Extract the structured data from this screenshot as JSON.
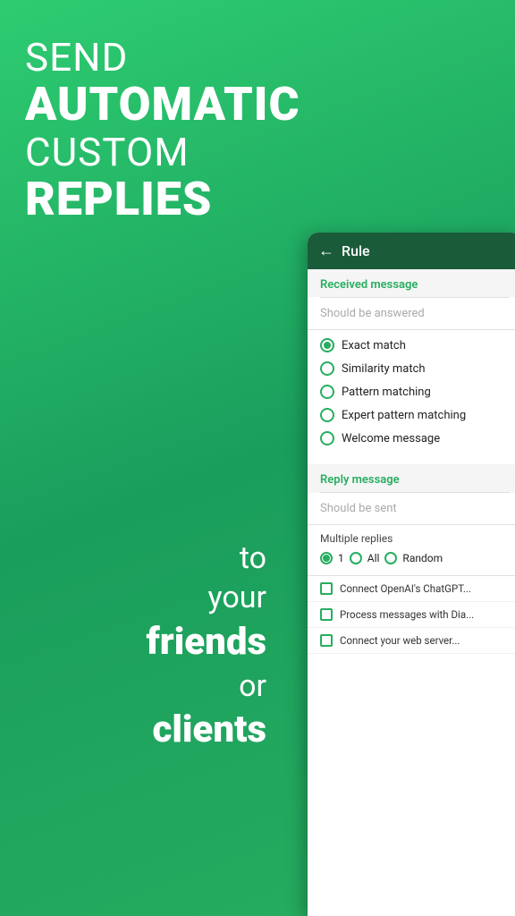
{
  "hero": {
    "send": "SEND",
    "automatic": "AUTOMATIC",
    "custom": "CUSTOM",
    "replies": "REPLIES"
  },
  "bottom": {
    "to": "to",
    "your": "your",
    "friends": "friends",
    "or": "or",
    "clients": "clients"
  },
  "topbar": {
    "back": "←",
    "title": "Rule"
  },
  "received_section": {
    "label": "Received message",
    "placeholder": "Should be answered"
  },
  "radio_options": [
    {
      "label": "Exact match",
      "selected": true
    },
    {
      "label": "Similarity match",
      "selected": false
    },
    {
      "label": "Pattern matching",
      "selected": false
    },
    {
      "label": "Expert pattern matching",
      "selected": false
    },
    {
      "label": "Welcome message",
      "selected": false
    }
  ],
  "reply_section": {
    "label": "Reply message",
    "placeholder": "Should be sent"
  },
  "multiple_replies": {
    "label": "Multiple replies",
    "options": [
      {
        "label": "1",
        "selected": true
      },
      {
        "label": "All",
        "selected": false
      },
      {
        "label": "Random",
        "selected": false
      }
    ]
  },
  "checkboxes": [
    {
      "label": "Connect OpenAI's ChatGPT..."
    },
    {
      "label": "Process messages with Dia..."
    },
    {
      "label": "Connect your web server..."
    }
  ]
}
